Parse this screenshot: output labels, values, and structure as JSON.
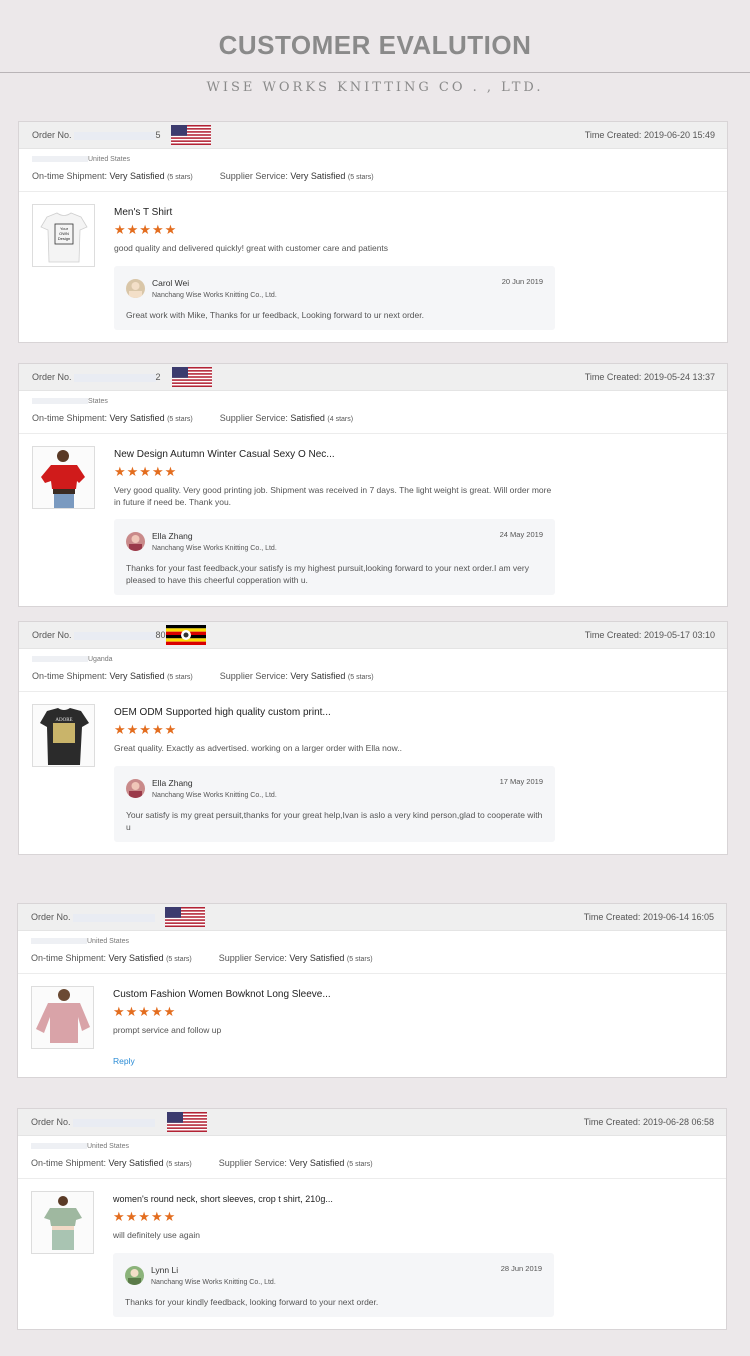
{
  "header": {
    "title": "CUSTOMER EVALUTION",
    "subtitle": "WISE WORKS KNITTING CO . , LTD."
  },
  "labels": {
    "order": "Order No.",
    "ontime": "On-time Shipment:",
    "supplier": "Supplier Service:",
    "time_created": "Time Created:",
    "reply": "Reply"
  },
  "reviews": [
    {
      "order_suffix": "5",
      "flag_icon": "us-flag-icon",
      "time_created": "2019-06-20 15:49",
      "location": "United States",
      "ontime": {
        "rating": "Very Satisfied",
        "stars": "(5 stars)"
      },
      "supplier": {
        "rating": "Very Satisfied",
        "stars": "(5 stars)"
      },
      "product_title": "Men's T Shirt",
      "stars": "★★★★★",
      "review_text": "good quality and delivered quickly! great with customer care and patients",
      "reply": {
        "name": "Carol Wei",
        "company": "Nanchang Wise Works Knitting Co., Ltd.",
        "date": "20 Jun 2019",
        "text": "Great work with Mike, Thanks for ur feedback, Looking forward to ur next order."
      },
      "thumb_text": "Your OWN Design"
    },
    {
      "order_suffix": "2",
      "flag_icon": "us-flag-icon",
      "time_created": "2019-05-24 13:37",
      "location": "States",
      "ontime": {
        "rating": "Very Satisfied",
        "stars": "(5 stars)"
      },
      "supplier": {
        "rating": "Satisfied",
        "stars": "(4 stars)"
      },
      "product_title": "New Design Autumn Winter Casual Sexy O Nec...",
      "stars": "★★★★★",
      "review_text": "Very good quality. Very good printing job. Shipment was received in 7 days. The light weight is great. Will order more in future if need be. Thank you.",
      "reply": {
        "name": "Ella Zhang",
        "company": "Nanchang Wise Works Knitting Co., Ltd.",
        "date": "24 May 2019",
        "text": "Thanks for your fast feedback,your satisfy is my highest pursuit,looking forward to your next order.I am very pleased to have this cheerful copperation with u."
      }
    },
    {
      "order_suffix": "80",
      "flag_icon": "uganda-flag-icon",
      "time_created": "2019-05-17 03:10",
      "location": "Uganda",
      "ontime": {
        "rating": "Very Satisfied",
        "stars": "(5 stars)"
      },
      "supplier": {
        "rating": "Very Satisfied",
        "stars": "(5 stars)"
      },
      "product_title": "OEM ODM Supported high quality custom print...",
      "stars": "★★★★★",
      "review_text": "Great quality. Exactly as advertised.  working on a larger order with Ella now..",
      "reply": {
        "name": "Ella Zhang",
        "company": "Nanchang Wise Works Knitting Co., Ltd.",
        "date": "17 May 2019",
        "text": "Your satisfy is my great persuit,thanks for your great help,Ivan is aslo a very kind person,glad to cooperate with u"
      },
      "thumb_text": "ADORE"
    },
    {
      "order_suffix": "",
      "flag_icon": "us-flag-icon",
      "time_created": "2019-06-14 16:05",
      "location": "United States",
      "ontime": {
        "rating": "Very Satisfied",
        "stars": "(5 stars)"
      },
      "supplier": {
        "rating": "Very Satisfied",
        "stars": "(5 stars)"
      },
      "product_title": "Custom Fashion Women Bowknot Long Sleeve...",
      "stars": "★★★★★",
      "review_text": "prompt service and follow up"
    },
    {
      "order_suffix": "",
      "flag_icon": "us-flag-icon",
      "time_created": "2019-06-28 06:58",
      "location": "United States",
      "ontime": {
        "rating": "Very Satisfied",
        "stars": "(5 stars)"
      },
      "supplier": {
        "rating": "Very Satisfied",
        "stars": "(5 stars)"
      },
      "product_title": "women's round neck, short sleeves, crop t shirt, 210g...",
      "stars": "★★★★★",
      "review_text": "will definitely use again",
      "reply": {
        "name": "Lynn Li",
        "company": "Nanchang Wise Works Knitting Co., Ltd.",
        "date": "28 Jun 2019",
        "text": "Thanks for your kindly feedback, looking forward to your next order."
      }
    }
  ],
  "colors": {
    "star": "#e36d1f",
    "link": "#2a8bd5",
    "page_bg": "#ece8ea"
  }
}
